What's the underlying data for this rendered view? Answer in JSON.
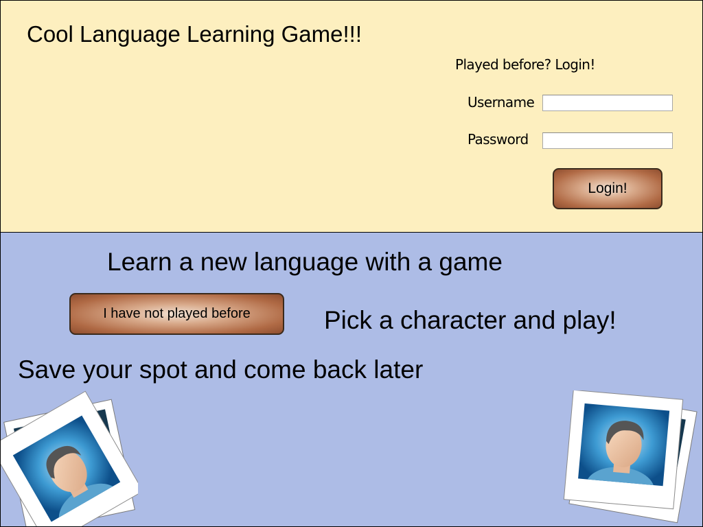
{
  "header": {
    "title": "Cool Language Learning Game!!!"
  },
  "login": {
    "heading": "Played before? Login!",
    "username_label": "Username",
    "username_value": "",
    "password_label": "Password",
    "password_value": "",
    "button_label": "Login!"
  },
  "promo": {
    "headline": "Learn a new language with a game",
    "new_player_button": "I have not played before",
    "pick_character": "Pick a character and play!",
    "save_spot": "Save your spot and come back later"
  },
  "icons": {
    "left_photo": "user-photo-icon",
    "right_photo": "user-photo-icon"
  },
  "colors": {
    "top_panel": "#fdefbf",
    "bottom_panel": "#adbce6",
    "button_brown": "#b06a45"
  }
}
